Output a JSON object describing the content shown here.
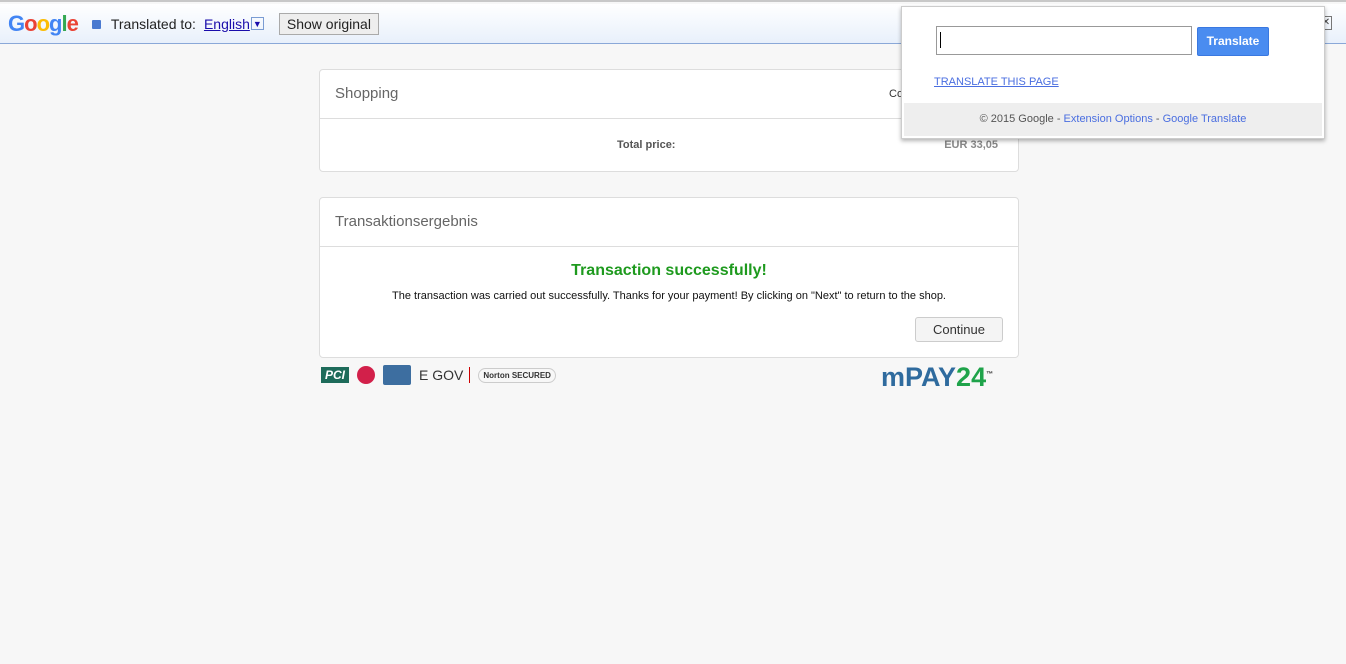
{
  "translate_bar": {
    "logo": "Google",
    "translated_to": "Translated to:",
    "language": "English",
    "dropdown": "▼",
    "show_original": "Show original",
    "close": "✕"
  },
  "shopping": {
    "title": "Shopping",
    "col_partial": "Co",
    "total_label": "Total price:",
    "total_value": "EUR 33,05"
  },
  "result": {
    "title": "Transaktionsergebnis",
    "headline": "Transaction successfully!",
    "message": "The transaction was carried out successfully. Thanks for your payment! By clicking on \"Next\" to return to the shop.",
    "continue": "Continue"
  },
  "logos": {
    "pci": "PCI",
    "egov": "E GOV",
    "norton": "Norton SECURED",
    "brand": "mPAY",
    "brand_num": "24",
    "tm": "™"
  },
  "popup": {
    "button": "Translate",
    "input_value": "",
    "translate_page": "TRANSLATE THIS PAGE",
    "copyright": "© 2015 Google - ",
    "extension_options": "Extension Options",
    "sep": " - ",
    "google_translate": "Google Translate"
  }
}
